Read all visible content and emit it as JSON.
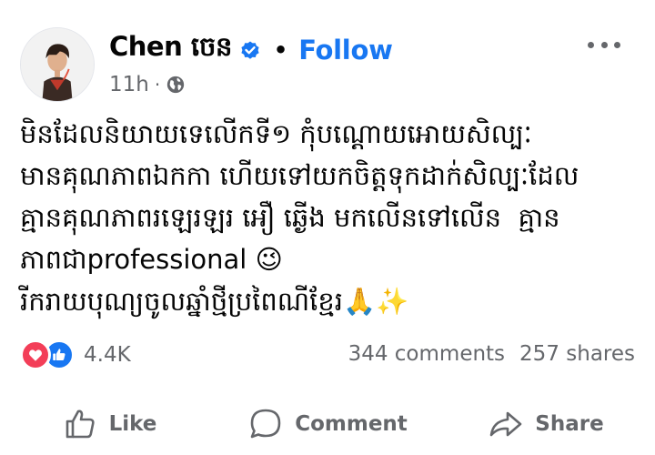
{
  "post": {
    "author_name": "Chen ចេន",
    "follow_label": "Follow",
    "separator": "•",
    "time": "11h",
    "time_separator": "·",
    "body": "មិនដែលនិយាយទេលើកទី១ កុំបណ្តោយអោយសិល្បៈ\nមានគុណភាពឯកកា ហើយទៅយកចិត្តទុកដាក់សិល្បៈដែល\nគ្មានគុណភាពរឡេរឡរ អឿ ឆ្ងើង មកលើនទៅលើន  គ្មាន\nភាពជាprofessional 😉\nរីករាយបុណ្យចូលឆ្នាំថ្មីប្រពៃណីខ្មែរ🙏✨",
    "reaction_count": "4.4K",
    "comments": "344 comments",
    "shares": "257 shares"
  },
  "actions": {
    "like_label": "Like",
    "comment_label": "Comment",
    "share_label": "Share"
  },
  "icons": {
    "verified": "verified-badge-icon",
    "globe": "globe-public-icon",
    "more": "more-horizontal-icon",
    "love": "love-reaction-icon",
    "like": "like-reaction-icon",
    "like_action": "thumbs-up-icon",
    "comment_action": "speech-bubble-icon",
    "share_action": "share-arrow-icon"
  },
  "colors": {
    "follow": "#1877f2",
    "secondary_text": "#65676b",
    "love_reaction": "#f33e58",
    "like_reaction": "#1877f2"
  }
}
